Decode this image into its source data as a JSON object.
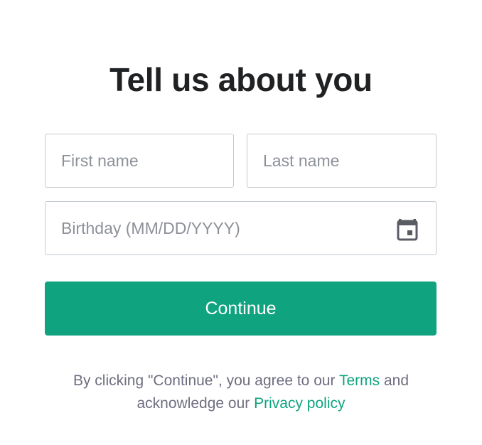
{
  "heading": "Tell us about you",
  "form": {
    "first_name": {
      "value": "",
      "placeholder": "First name"
    },
    "last_name": {
      "value": "",
      "placeholder": "Last name"
    },
    "birthday": {
      "value": "",
      "placeholder": "Birthday (MM/DD/YYYY)"
    },
    "calendar_icon": "calendar-icon",
    "continue_label": "Continue"
  },
  "legal": {
    "prefix": "By clicking \"Continue\", you agree to our ",
    "terms_link": "Terms",
    "middle": " and",
    "line2_prefix": "acknowledge our ",
    "privacy_link": "Privacy policy"
  },
  "colors": {
    "accent": "#10a37f",
    "heading_text": "#202123",
    "muted_text": "#6e6e80",
    "border": "#c2c8d0"
  }
}
